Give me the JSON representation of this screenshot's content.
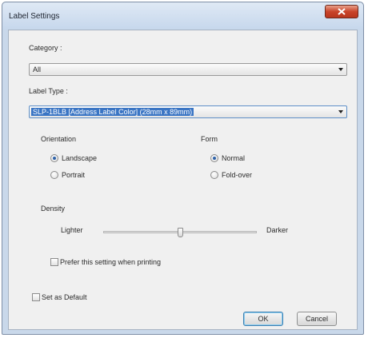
{
  "window": {
    "title": "Label Settings"
  },
  "category": {
    "label": "Category :",
    "value": "All"
  },
  "label_type": {
    "label": "Label Type :",
    "value": "SLP-1BLB [Address Label Color] (28mm x 89mm)"
  },
  "orientation": {
    "heading": "Orientation",
    "options": [
      "Landscape",
      "Portrait"
    ],
    "selected": "Landscape"
  },
  "form": {
    "heading": "Form",
    "options": [
      "Normal",
      "Fold-over"
    ],
    "selected": "Normal"
  },
  "density": {
    "heading": "Density",
    "min_label": "Lighter",
    "max_label": "Darker",
    "level": 0.5
  },
  "prefer_setting": {
    "label": "Prefer this setting when printing",
    "checked": false
  },
  "set_default": {
    "label": "Set as Default",
    "checked": false
  },
  "buttons": {
    "ok": "OK",
    "cancel": "Cancel"
  },
  "colors": {
    "selection": "#3a75c4",
    "close_button": "#c9442a",
    "dialog_background": "#f0f0f0",
    "frame": "#c9d8ea"
  }
}
